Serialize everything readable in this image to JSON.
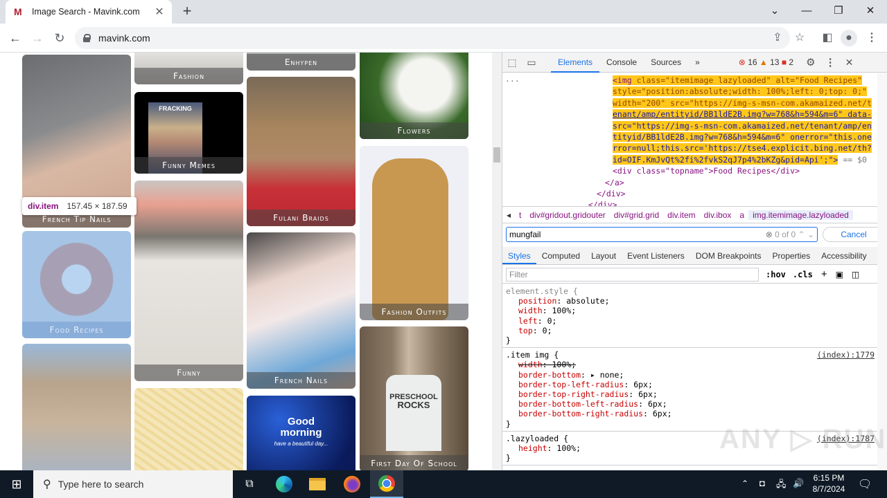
{
  "browser": {
    "tab_title": "Image Search - Mavink.com",
    "favicon": "M",
    "url": "mavink.com"
  },
  "page": {
    "cards": [
      {
        "caption": "French Tip Nails",
        "color": "#b9a59a"
      },
      {
        "caption": "Food Recipes",
        "color": "#9fc0e3"
      },
      {
        "caption": "",
        "color": "#c6b9a6"
      },
      {
        "caption": "Fashion",
        "color": "#d3cfcb"
      },
      {
        "caption": "Funny Memes",
        "color": "#1a1a1a"
      },
      {
        "caption": "Funny",
        "color": "#d9d4cf"
      },
      {
        "caption": "",
        "color": "#f2e4b9"
      },
      {
        "caption": "Enhypen",
        "color": "#9a9a9a"
      },
      {
        "caption": "Fulani Braids",
        "color": "#a88565"
      },
      {
        "caption": "French Nails",
        "color": "#c9b3a6"
      },
      {
        "caption": "",
        "color": "#1b3b8c"
      },
      {
        "caption": "Flowers",
        "color": "#6c8c5c"
      },
      {
        "caption": "Fashion Outfits",
        "color": "#c99a55"
      },
      {
        "caption": "First Day Of School",
        "color": "#8a7a68"
      }
    ],
    "meme_text": "FRACKING",
    "greeting_text": [
      "Good",
      "morning",
      "have a beautiful day..."
    ],
    "shirt_text": [
      "PRESCHOOL",
      "ROCKS"
    ],
    "tooltip": {
      "tag": "div.item",
      "dims": "157.45 × 187.59"
    }
  },
  "devtools": {
    "tabs": [
      "Elements",
      "Console",
      "Sources"
    ],
    "more": "»",
    "errors": "16",
    "warnings": "13",
    "issues": "2",
    "dom_lines": {
      "ellipsis": "...",
      "l1_tag": "<img",
      "l1_rest": " class=\"itemimage lazyloaded\" alt=\"Food Recipes\"",
      "l2": "style=\"position:absolute;width: 100%;left: 0;top: 0;\"",
      "l3": "width=\"200\" src=\"https://img-s-msn-com.akamaized.net/t",
      "l4": "enant/amp/entityid/BB1ldE2B.img?w=768&h=594&m=6\" data-",
      "l5": "src=\"https://img-s-msn-com.akamaized.net/tenant/amp/en",
      "l6": "tityid/BB1ldE2B.img?w=768&h=594&m=6\" onerror=\"this.one",
      "l7": "rror=null;this.src='https://tse4.explicit.bing.net/th?",
      "l8": "id=OIF.KmJvQt%2fi%2fvkS2qJ7p4%2bKZg&pid=Api';\">",
      "l8_suffix": " == $0",
      "l9": "<div class=\"topname\">Food Recipes</div>",
      "l10": "</a>",
      "l11": "</div>",
      "l12": "</div>"
    },
    "breadcrumbs": [
      "t",
      "div#gridout.gridouter",
      "div#grid.grid",
      "div.item",
      "div.ibox",
      "a",
      "img.itemimage.lazyloaded"
    ],
    "search": {
      "value": "mungfail",
      "count": "0 of 0",
      "cancel": "Cancel"
    },
    "subtabs": [
      "Styles",
      "Computed",
      "Layout",
      "Event Listeners",
      "DOM Breakpoints",
      "Properties",
      "Accessibility"
    ],
    "filter_placeholder": "Filter",
    "hov": ":hov",
    "cls": ".cls",
    "rules": [
      {
        "selector": "element.style {",
        "source": "",
        "props": [
          [
            "position",
            "absolute"
          ],
          [
            "width",
            "100%"
          ],
          [
            "left",
            "0"
          ],
          [
            "top",
            "0"
          ]
        ]
      },
      {
        "selector": ".item img {",
        "source": "(index):1779",
        "props": [
          [
            "width",
            "100%",
            "struck"
          ],
          [
            "border-bottom",
            "▸ none"
          ],
          [
            "border-top-left-radius",
            "6px"
          ],
          [
            "border-top-right-radius",
            "6px"
          ],
          [
            "border-bottom-left-radius",
            "6px"
          ],
          [
            "border-bottom-right-radius",
            "6px"
          ]
        ]
      },
      {
        "selector": ".lazyloaded {",
        "source": "(index):1787",
        "props": [
          [
            "height",
            "100%"
          ]
        ]
      }
    ]
  },
  "taskbar": {
    "search_placeholder": "Type here to search",
    "time": "6:15 PM",
    "date": "8/7/2024"
  },
  "watermark": "ANY ▷ RUN"
}
